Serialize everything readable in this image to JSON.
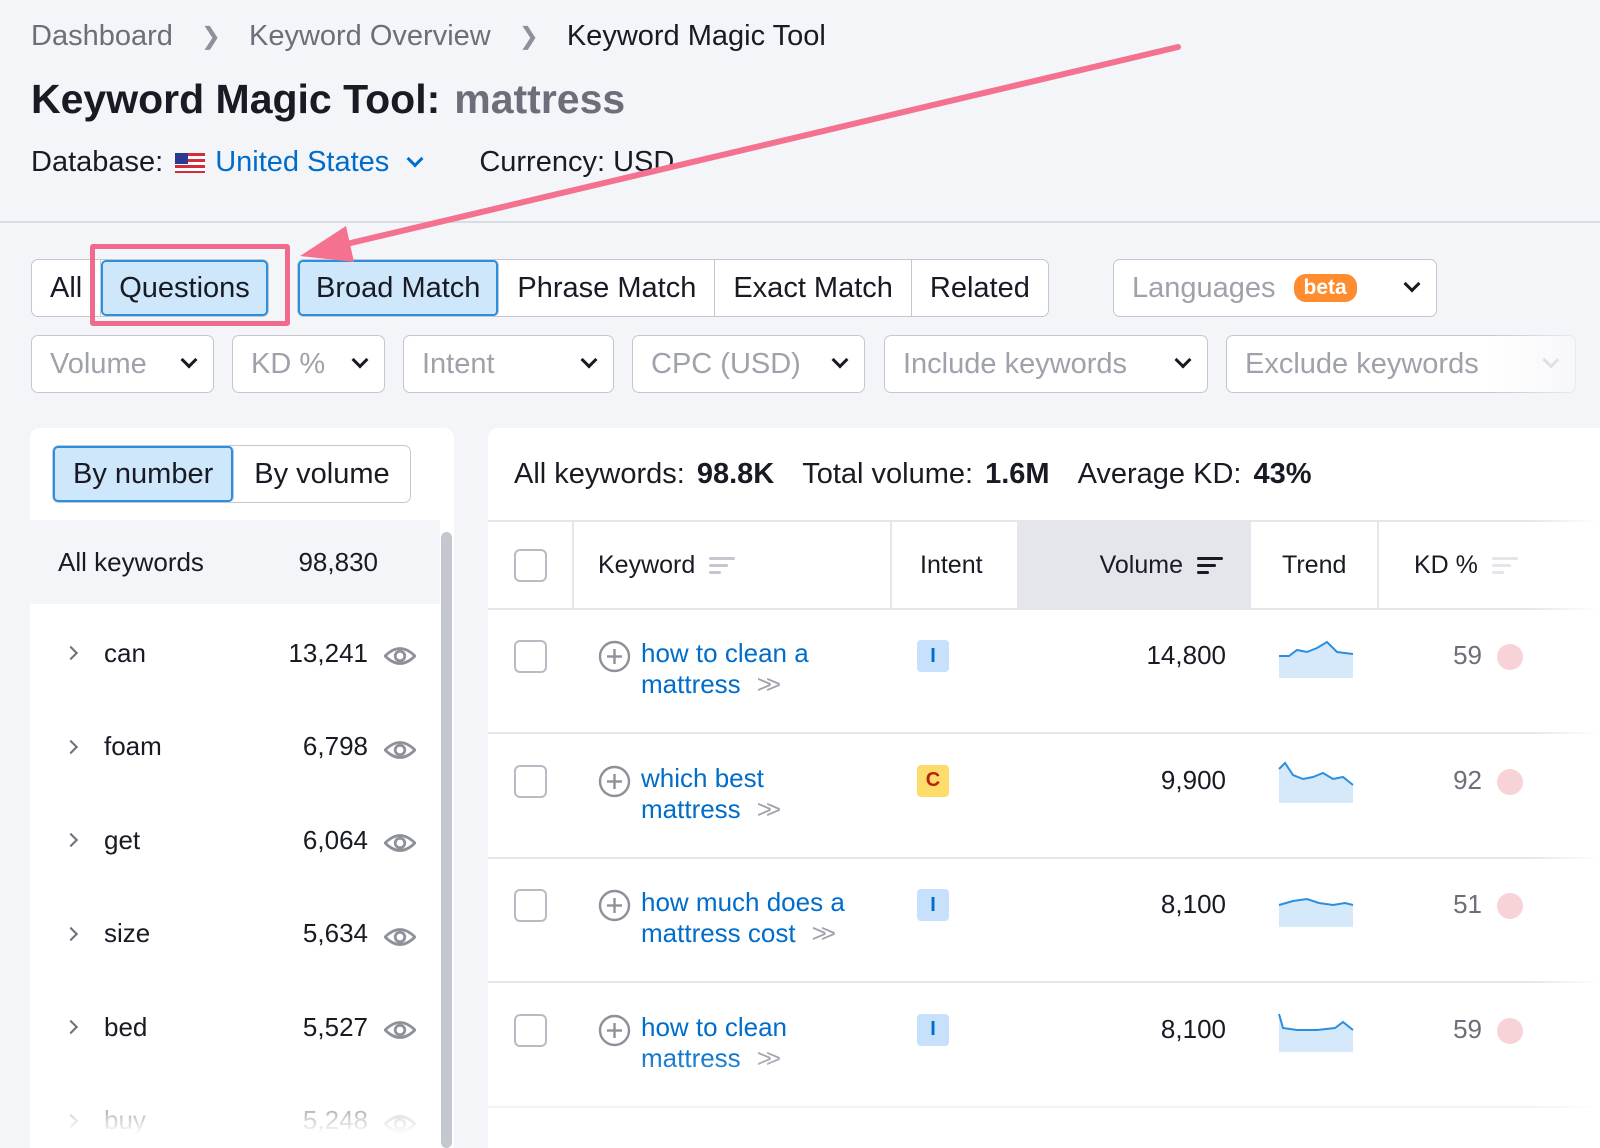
{
  "breadcrumb": [
    "Dashboard",
    "Keyword Overview",
    "Keyword Magic Tool"
  ],
  "title": {
    "label": "Keyword Magic Tool:",
    "query": "mattress"
  },
  "database": {
    "label": "Database:",
    "value": "United States"
  },
  "currency": "Currency: USD",
  "match_tabs": {
    "group1": [
      "All",
      "Questions"
    ],
    "group2": [
      "Broad Match",
      "Phrase Match",
      "Exact Match",
      "Related"
    ]
  },
  "languages": {
    "label": "Languages",
    "badge": "beta"
  },
  "filters": [
    "Volume",
    "KD %",
    "Intent",
    "CPC (USD)",
    "Include keywords",
    "Exclude keywords"
  ],
  "left_panel": {
    "toggle": [
      "By number",
      "By volume"
    ],
    "all_label": "All keywords",
    "all_count": "98,830",
    "groups": [
      {
        "name": "can",
        "count": "13,241"
      },
      {
        "name": "foam",
        "count": "6,798"
      },
      {
        "name": "get",
        "count": "6,064"
      },
      {
        "name": "size",
        "count": "5,634"
      },
      {
        "name": "bed",
        "count": "5,527"
      },
      {
        "name": "buy",
        "count": "5,248"
      }
    ]
  },
  "summary": {
    "all_keywords_label": "All keywords:",
    "all_keywords": "98.8K",
    "total_volume_label": "Total volume:",
    "total_volume": "1.6M",
    "avg_kd_label": "Average KD:",
    "avg_kd": "43%"
  },
  "table": {
    "headers": {
      "keyword": "Keyword",
      "intent": "Intent",
      "volume": "Volume",
      "trend": "Trend",
      "kd": "KD %"
    },
    "rows": [
      {
        "line1": "how to clean a",
        "line2": "mattress",
        "intent": "I",
        "volume": "14,800",
        "kd": "59"
      },
      {
        "line1": "which best",
        "line2": "mattress",
        "intent": "C",
        "volume": "9,900",
        "kd": "92"
      },
      {
        "line1": "how much does a",
        "line2": "mattress cost",
        "intent": "I",
        "volume": "8,100",
        "kd": "51"
      },
      {
        "line1": "how to clean",
        "line2": "mattress",
        "intent": "I",
        "volume": "8,100",
        "kd": "59"
      }
    ]
  },
  "colors": {
    "accent": "#006dca",
    "highlight": "#ef6a8c",
    "selected_bg": "#cfe7fb"
  }
}
